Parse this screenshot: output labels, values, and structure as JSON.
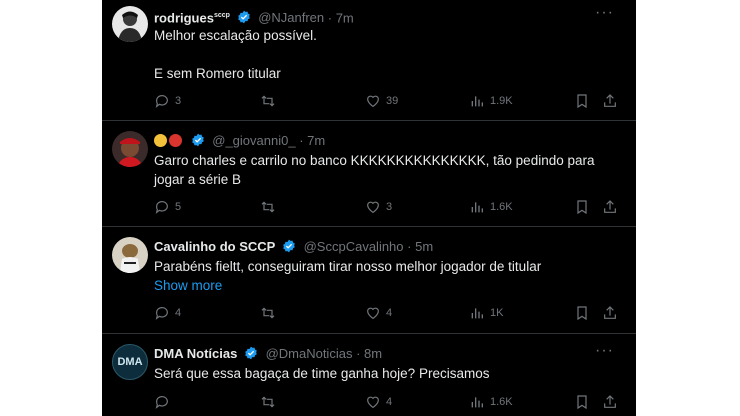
{
  "tweets": [
    {
      "name": "rodrigues",
      "name_sup": "sccp",
      "handle": "@NJanfren",
      "time": "· 7m",
      "lines": [
        "Melhor escalação possível.",
        "",
        "E sem Romero titular"
      ],
      "replies": "3",
      "retweets": "",
      "likes": "39",
      "views": "1.9K"
    },
    {
      "name": "",
      "handle": "@_giovanni0_",
      "time": "· 7m",
      "lines": [
        "Garro charles e carrilo no banco KKKKKKKKKKKKKKK, tão pedindo para",
        "jogar a série B"
      ],
      "replies": "5",
      "retweets": "",
      "likes": "3",
      "views": "1.6K"
    },
    {
      "name": "Cavalinho do SCCP",
      "handle": "@SccpCavalinho",
      "time": "· 5m",
      "lines": [
        "Parabéns fieltt, conseguiram tirar nosso melhor jogador de titular"
      ],
      "show_more": "Show more",
      "replies": "4",
      "retweets": "",
      "likes": "4",
      "views": "1K"
    },
    {
      "name": "DMA Notícias",
      "handle": "@DmaNoticias",
      "time": "· 8m",
      "avatar_text": "DMA",
      "lines": [
        "Será que essa bagaça de time ganha hoje? Precisamos"
      ],
      "replies": "",
      "retweets": "",
      "likes": "4",
      "views": "1.6K"
    }
  ],
  "colors": {
    "background": "#000000",
    "text": "#e7e9ea",
    "muted": "#71767b",
    "verified": "#1d9bf0",
    "link": "#1d9bf0"
  }
}
